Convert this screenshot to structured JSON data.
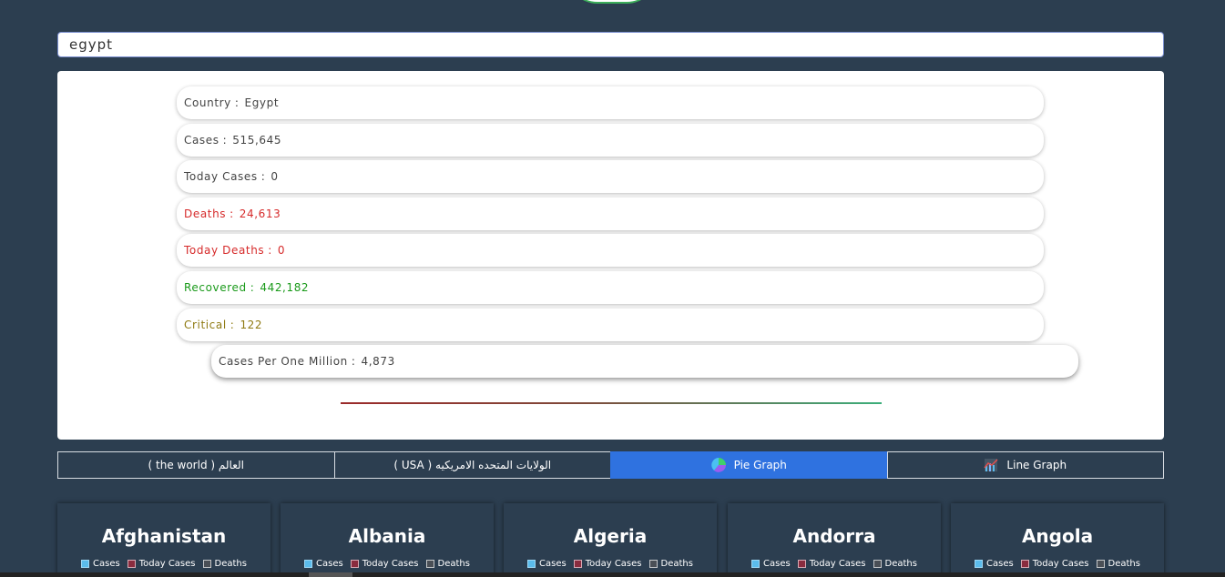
{
  "search": {
    "value": "egypt"
  },
  "stats": [
    {
      "label": "Country",
      "value": "Egypt",
      "color": "#444444"
    },
    {
      "label": "Cases",
      "value": "515,645",
      "color": "#444444"
    },
    {
      "label": "Today Cases",
      "value": "0",
      "color": "#444444"
    },
    {
      "label": "Deaths",
      "value": "24,613",
      "color": "#d62a2a"
    },
    {
      "label": "Today Deaths",
      "value": "0",
      "color": "#d62a2a"
    },
    {
      "label": "Recovered",
      "value": "442,182",
      "color": "#1a9a1a"
    },
    {
      "label": "Critical",
      "value": "122",
      "color": "#8f7a12"
    },
    {
      "label": "Cases Per One Million",
      "value": "4,873",
      "color": "#444444"
    }
  ],
  "tabs": [
    {
      "label": "العالم ( the world )",
      "icon": ""
    },
    {
      "label": "الولايات المتحده الامريكيه ( USA )",
      "icon": ""
    },
    {
      "label": "Pie Graph",
      "icon": "pie-chart-icon"
    },
    {
      "label": "Line Graph",
      "icon": "line-chart-icon"
    }
  ],
  "legend": {
    "cases": "Cases",
    "today_cases": "Today Cases",
    "deaths": "Deaths"
  },
  "cards": [
    {
      "name": "Afghanistan"
    },
    {
      "name": "Albania"
    },
    {
      "name": "Algeria"
    },
    {
      "name": "Andorra"
    },
    {
      "name": "Angola"
    }
  ],
  "colors": {
    "background": "#2c3e50",
    "accent": "#2f72e0",
    "deaths": "#d62a2a",
    "recovered": "#1a9a1a",
    "critical": "#8f7a12"
  }
}
